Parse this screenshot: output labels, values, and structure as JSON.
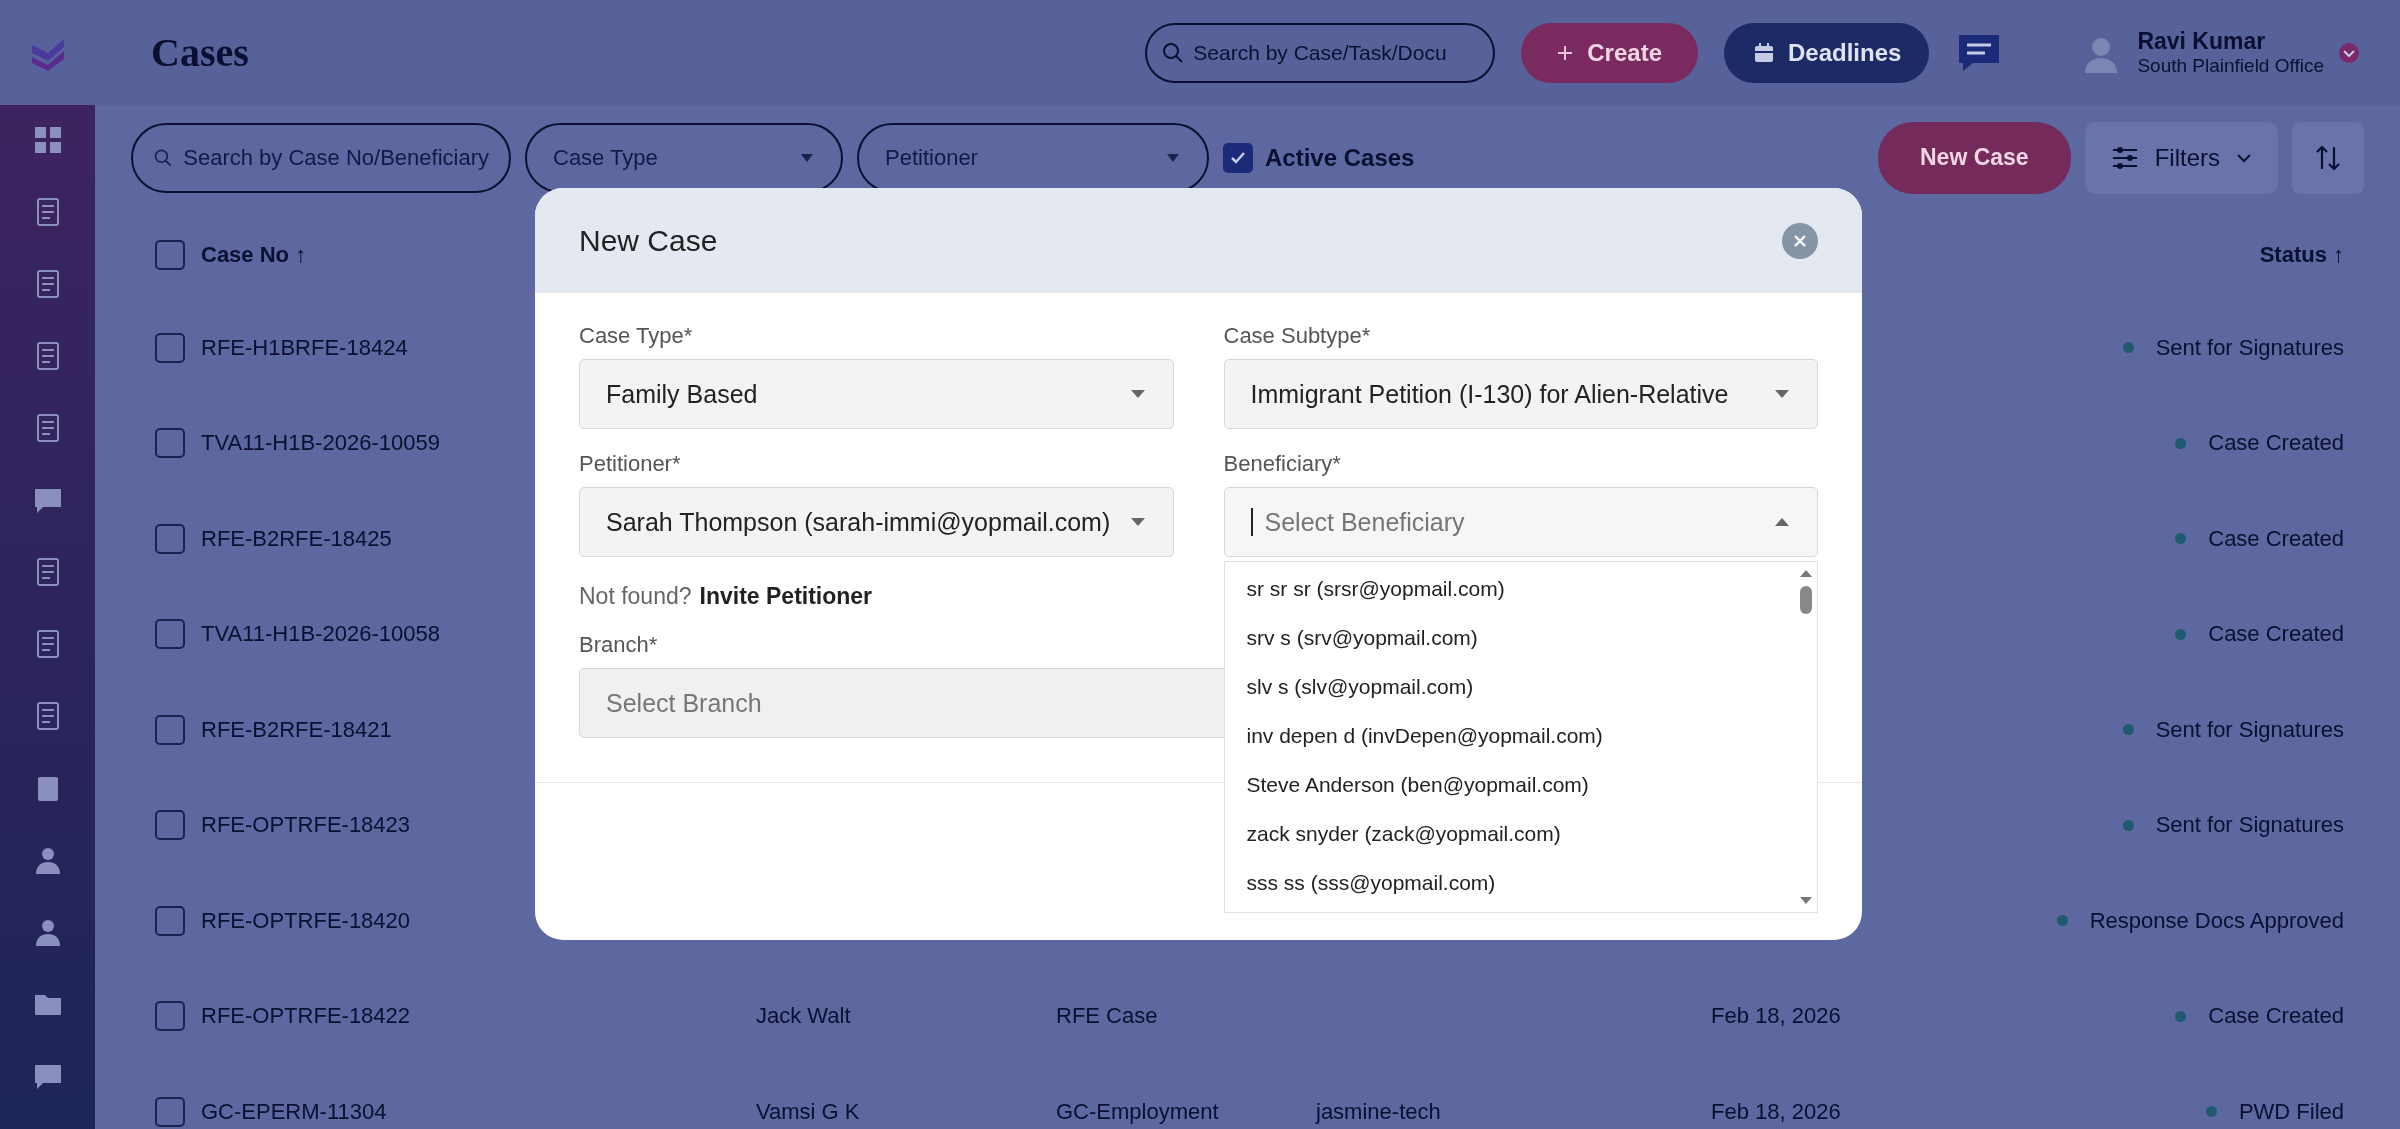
{
  "header": {
    "title": "Cases",
    "search": {
      "placeholder": "Search by Case/Task/Docu"
    },
    "create_button": "Create",
    "deadlines_button": "Deadlines",
    "user": {
      "name": "Ravi Kumar",
      "office": "South Plainfield Office"
    }
  },
  "toolbar": {
    "search": {
      "placeholder": "Search by Case No/Beneficiary"
    },
    "case_type": {
      "placeholder": "Case Type"
    },
    "petitioner": {
      "placeholder": "Petitioner"
    },
    "active_cases": {
      "label": "Active Cases",
      "checked": true
    },
    "new_case_button": "New Case",
    "filters_button": "Filters"
  },
  "table": {
    "select_all_checked": false,
    "columns": [
      "Case No ↑",
      "Status ↑"
    ],
    "rows": [
      {
        "checked": false,
        "case_no": "RFE-H1BRFE-18424",
        "status": "Sent for Signatures"
      },
      {
        "checked": false,
        "case_no": "TVA11-H1B-2026-10059",
        "status": "Case Created"
      },
      {
        "checked": false,
        "case_no": "RFE-B2RFE-18425",
        "status": "Case Created"
      },
      {
        "checked": false,
        "case_no": "TVA11-H1B-2026-10058",
        "status": "Case Created"
      },
      {
        "checked": false,
        "case_no": "RFE-B2RFE-18421",
        "status": "Sent for Signatures"
      },
      {
        "checked": false,
        "case_no": "RFE-OPTRFE-18423",
        "status": "Sent for Signatures"
      },
      {
        "checked": false,
        "case_no": "RFE-OPTRFE-18420",
        "status": "Response Docs Approved"
      },
      {
        "checked": false,
        "case_no": "RFE-OPTRFE-18422",
        "beneficiary": "Jack Walt",
        "case_type": "RFE Case",
        "date": "Feb 18, 2026",
        "status": "Case Created"
      },
      {
        "checked": false,
        "case_no": "GC-EPERM-11304",
        "beneficiary": "Vamsi G K",
        "case_type": "GC-Employment",
        "company": "jasmine-tech",
        "date": "Feb 18, 2026",
        "status": "PWD Filed"
      }
    ]
  },
  "modal": {
    "title": "New Case",
    "fields": [
      {
        "label": "Case Type*",
        "value": "Family Based",
        "expanded": false
      },
      {
        "label": "Case Subtype*",
        "value": "Immigrant Petition (I-130) for Alien-Relative",
        "expanded": false
      },
      {
        "label": "Petitioner*",
        "value": "Sarah Thompson (sarah-immi@yopmail.com)",
        "expanded": false
      },
      {
        "label": "Beneficiary*",
        "placeholder": "Select Beneficiary",
        "expanded": true,
        "options": [
          "sr sr sr (srsr@yopmail.com)",
          "srv s (srv@yopmail.com)",
          "slv s (slv@yopmail.com)",
          "inv depen d (invDepen@yopmail.com)",
          "Steve Anderson (ben@yopmail.com)",
          "zack snyder (zack@yopmail.com)",
          "sss ss (sss@yopmail.com)"
        ]
      }
    ],
    "not_found": {
      "text": "Not found?",
      "link": "Invite Petitioner"
    },
    "branch": {
      "label": "Branch*",
      "placeholder": "Select Branch"
    }
  }
}
